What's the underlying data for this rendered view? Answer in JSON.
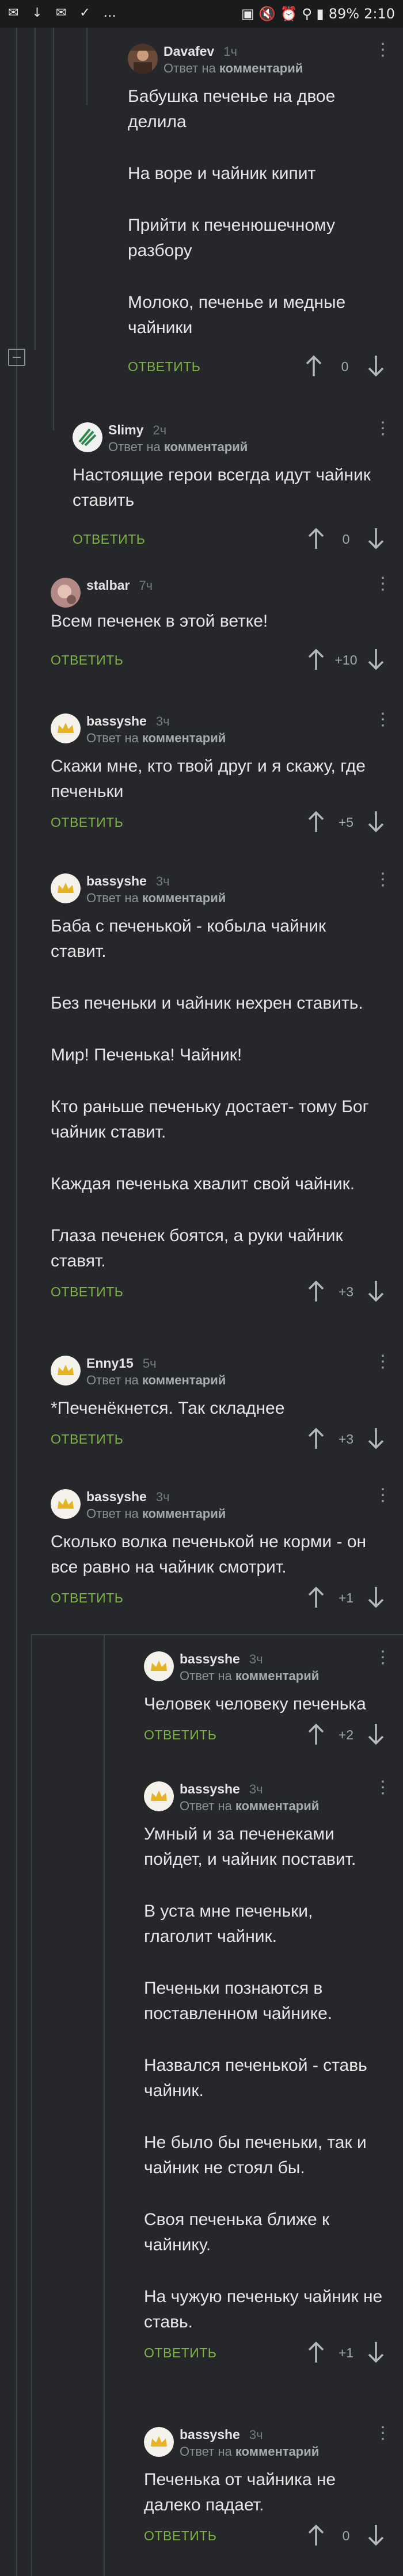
{
  "status_bar": {
    "left_icons": "✉ ↓ ✉ ✓ …",
    "right_icons": "▣ 🔇 ⏰ ⚲ ▮",
    "battery": "89%",
    "time": "2:10"
  },
  "labels": {
    "reply": "ОТВЕТИТЬ",
    "reply_prefix": "Ответ на ",
    "reply_target": "комментарий"
  },
  "colors": {
    "background": "#25272b",
    "reply_green": "#7cb342",
    "text": "#e6e6e6",
    "meta": "#8b8f94"
  },
  "comments": [
    {
      "author": "Davafev",
      "time": "1ч",
      "avatar": "photo-avatar",
      "paragraphs": [
        "Бабушка печенье на двое делила",
        "На воре и чайник кипит",
        "Прийти к печенюшечному разбору",
        "Молоко, печенье и медные чайники"
      ],
      "score": "0"
    },
    {
      "author": "Slimy",
      "time": "2ч",
      "avatar": "logo-avatar",
      "paragraphs": [
        "Настоящие герои всегда идут чайник ставить"
      ],
      "score": "0"
    },
    {
      "author": "stalbar",
      "time": "7ч",
      "avatar": "photo-avatar",
      "paragraphs": [
        "Всем печенек в этой ветке!"
      ],
      "score": "+10"
    },
    {
      "author": "bassyshe",
      "time": "3ч",
      "avatar": "crown-avatar",
      "paragraphs": [
        "Скажи мне, кто твой друг и я скажу, где печеньки"
      ],
      "score": "+5"
    },
    {
      "author": "bassyshe",
      "time": "3ч",
      "avatar": "crown-avatar",
      "paragraphs": [
        "Баба с печенькой - кобыла чайник ставит.",
        "Без печеньки и чайник нехрен ставить.",
        "Мир! Печенька! Чайник!",
        "Кто раньше печеньку достает- тому Бог чайник ставит.",
        "Каждая печенька хвалит свой чайник.",
        "Глаза печенек боятся, а руки чайник ставят."
      ],
      "score": "+3"
    },
    {
      "author": "Enny15",
      "time": "5ч",
      "avatar": "crown-avatar",
      "paragraphs": [
        "*Печенёкнется. Так складнее"
      ],
      "score": "+3"
    },
    {
      "author": "bassyshe",
      "time": "3ч",
      "avatar": "crown-avatar",
      "paragraphs": [
        "Сколько волка печенькой не корми - он все равно на чайник смотрит."
      ],
      "score": "+1"
    },
    {
      "author": "bassyshe",
      "time": "3ч",
      "avatar": "crown-avatar",
      "paragraphs": [
        "Человек человеку печенька"
      ],
      "score": "+2"
    },
    {
      "author": "bassyshe",
      "time": "3ч",
      "avatar": "crown-avatar",
      "paragraphs": [
        "Умный и за печенеками пойдет, и чайник поставит.",
        "В уста мне печеньки, глаголит чайник.",
        "Печеньки познаются в поставленном чайнике.",
        "Назвался печенькой - ставь чайник.",
        "Не было бы печеньки, так и чайник не стоял бы.",
        "Своя печенька ближе к чайнику.",
        "На чужую печеньку чайник не ставь."
      ],
      "score": "+1"
    },
    {
      "author": "bassyshe",
      "time": "3ч",
      "avatar": "crown-avatar",
      "paragraphs": [
        "Печенька от чайника не далеко падает."
      ],
      "score": "0"
    }
  ]
}
